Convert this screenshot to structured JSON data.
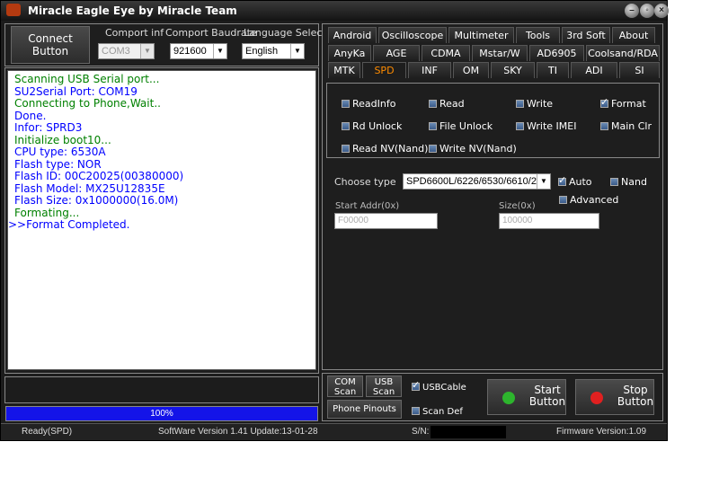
{
  "window": {
    "title": "Miracle Eagle Eye by Miracle Team"
  },
  "connect": {
    "label": "Connect Button"
  },
  "comport": {
    "label": "Comport inf",
    "value": "COM3"
  },
  "baud": {
    "label": "Comport Baudrate",
    "value": "921600"
  },
  "language": {
    "label": "Language Select",
    "value": "English"
  },
  "log": [
    {
      "text": "Scanning USB Serial port...",
      "color": "#008000"
    },
    {
      "text": "SU2Serial Port: COM19",
      "color": "#0000ff"
    },
    {
      "text": "Connecting to Phone,Wait..",
      "color": "#008000"
    },
    {
      "text": "Done.",
      "color": "#0000ff"
    },
    {
      "text": "Infor: SPRD3",
      "color": "#0000ff"
    },
    {
      "text": "Initialize boot10...",
      "color": "#008000"
    },
    {
      "text": "CPU    type: 6530A",
      "color": "#0000ff"
    },
    {
      "text": "Flash  type: NOR",
      "color": "#0000ff"
    },
    {
      "text": "Flash    ID: 00C20025(00380000)",
      "color": "#0000ff"
    },
    {
      "text": "Flash Model: MX25U12835E",
      "color": "#0000ff"
    },
    {
      "text": "Flash  Size: 0x1000000(16.0M)",
      "color": "#0000ff"
    },
    {
      "text": "Formating...",
      "color": "#008000"
    },
    {
      "text": ">>Format Completed.",
      "color": "#0000ff"
    }
  ],
  "progress": {
    "label": "100%",
    "value": 1.0
  },
  "tabs": {
    "row1": [
      "Android",
      "Oscilloscope",
      "Multimeter",
      "Tools",
      "3rd Soft",
      "About"
    ],
    "row2": [
      "AnyKa",
      "AGE",
      "CDMA",
      "Mstar/W",
      "AD6905",
      "Coolsand/RDA"
    ],
    "row3": [
      "MTK",
      "SPD",
      "INF",
      "OM",
      "SKY",
      "TI",
      "ADI",
      "SI"
    ],
    "active": "SPD"
  },
  "ops": {
    "readinfo": "ReadInfo",
    "read": "Read",
    "write": "Write",
    "format": "Format",
    "rd_unlock": "Rd Unlock",
    "file_unlock": "File Unlock",
    "write_imei": "Write IMEI",
    "main_clr": "Main Clr",
    "read_nv": "Read NV(Nand)",
    "write_nv": "Write NV(Nand)"
  },
  "spd": {
    "choose_type_label": "Choose  type",
    "choose_type_value": "SPD6600L/6226/6530/6610/20",
    "auto": "Auto",
    "nand": "Nand",
    "advanced": "Advanced",
    "start_addr_label": "Start Addr(0x)",
    "start_addr_value": "F00000",
    "size_label": "Size(0x)",
    "size_value": "100000"
  },
  "bottom": {
    "com_scan": "COM Scan",
    "usb_scan": "USB Scan",
    "usb_cable": "USBCable",
    "phone_pinouts": "Phone Pinouts",
    "scan_def": "Scan Def",
    "start": "Start Button",
    "stop": "Stop Button"
  },
  "statusbar": {
    "ready": "Ready(SPD)",
    "version": "SoftWare Version 1.41  Update:13-01-28",
    "sn": "S/N:",
    "firmware": "Firmware Version:1.09"
  },
  "colors": {
    "active_tab": "#ff8c00",
    "progress": "#1414e8",
    "start_icon": "#2db52d",
    "stop_icon": "#e02020"
  }
}
